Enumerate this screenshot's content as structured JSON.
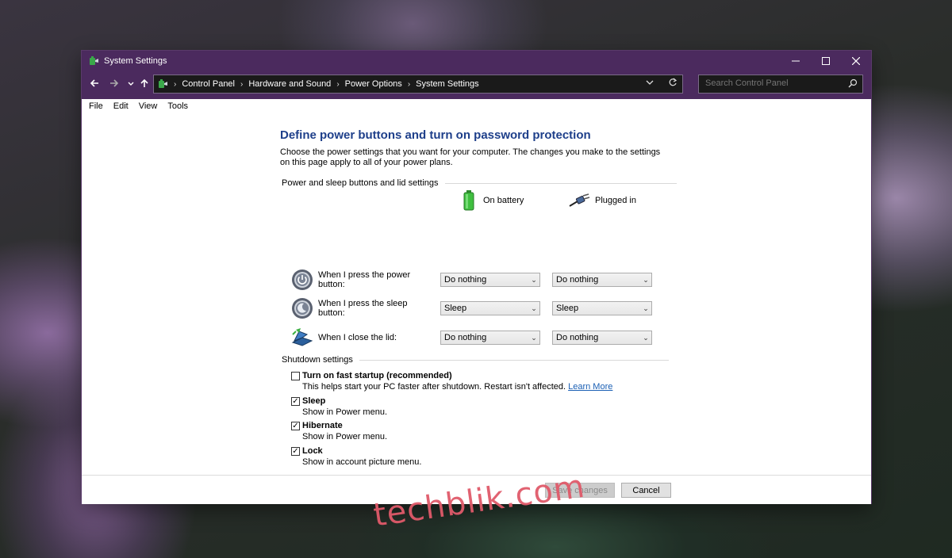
{
  "window": {
    "title": "System Settings"
  },
  "address": {
    "breadcrumb": [
      "Control Panel",
      "Hardware and Sound",
      "Power Options",
      "System Settings"
    ]
  },
  "search": {
    "placeholder": "Search Control Panel"
  },
  "menu": [
    "File",
    "Edit",
    "View",
    "Tools"
  ],
  "main": {
    "title": "Define power buttons and turn on password protection",
    "description": "Choose the power settings that you want for your computer. The changes you make to the settings on this page apply to all of your power plans.",
    "power_group": {
      "header": "Power and sleep buttons and lid settings",
      "col_battery": "On battery",
      "col_plugged": "Plugged in",
      "rows": [
        {
          "label": "When I press the power button:",
          "battery": "Do nothing",
          "plugged": "Do nothing"
        },
        {
          "label": "When I press the sleep button:",
          "battery": "Sleep",
          "plugged": "Sleep"
        },
        {
          "label": "When I close the lid:",
          "battery": "Do nothing",
          "plugged": "Do nothing"
        }
      ]
    },
    "shutdown_group": {
      "header": "Shutdown settings",
      "items": [
        {
          "title": "Turn on fast startup (recommended)",
          "desc": "This helps start your PC faster after shutdown. Restart isn't affected.",
          "link": "Learn More",
          "checked": false
        },
        {
          "title": "Sleep",
          "desc": "Show in Power menu.",
          "checked": true
        },
        {
          "title": "Hibernate",
          "desc": "Show in Power menu.",
          "checked": true
        },
        {
          "title": "Lock",
          "desc": "Show in account picture menu.",
          "checked": true
        }
      ]
    }
  },
  "footer": {
    "save_label": "Save changes",
    "cancel_label": "Cancel"
  },
  "watermark": "techblik.com",
  "colors": {
    "titlebar": "#4b2a5e",
    "heading": "#1e3f8a",
    "link": "#1a5fb4"
  }
}
